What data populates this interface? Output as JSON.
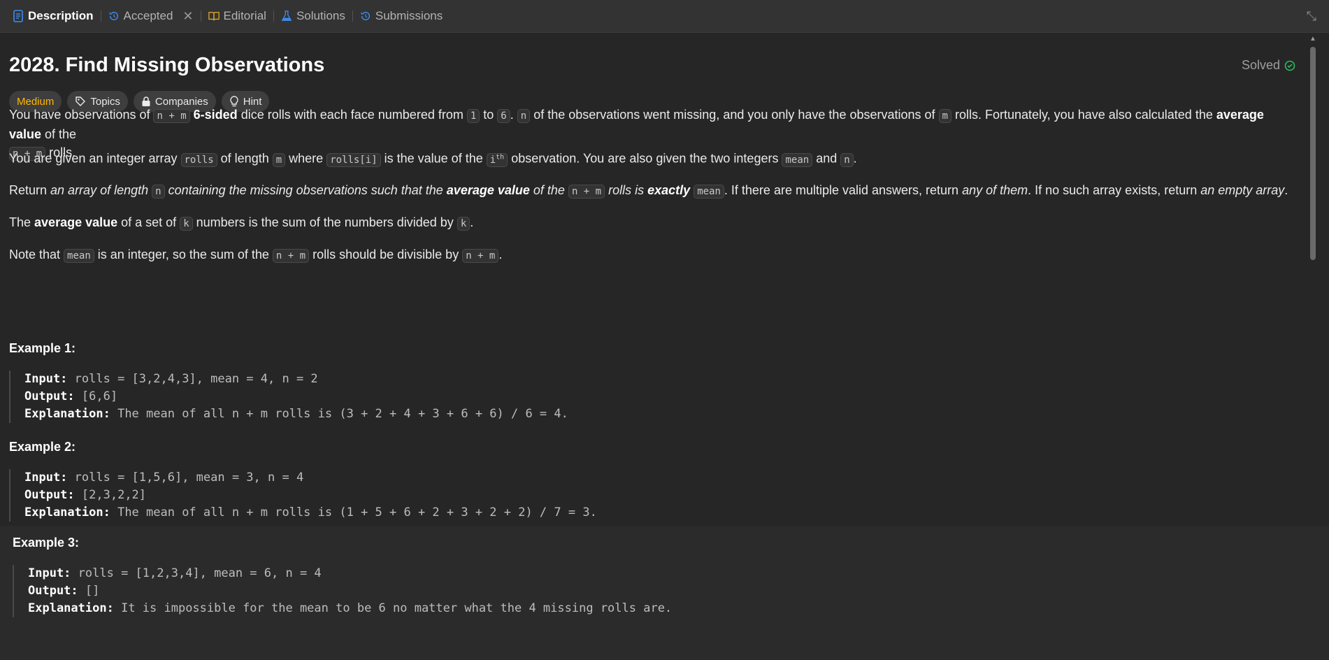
{
  "tabs": [
    {
      "label": "Description",
      "icon": "document-icon",
      "active": true
    },
    {
      "label": "Accepted",
      "icon": "history-icon",
      "closable": true
    },
    {
      "label": "Editorial",
      "icon": "book-icon"
    },
    {
      "label": "Solutions",
      "icon": "flask-icon"
    },
    {
      "label": "Submissions",
      "icon": "history-icon"
    }
  ],
  "problem": {
    "title": "2028. Find Missing Observations",
    "status": "Solved",
    "difficulty": "Medium",
    "tags": [
      "Topics",
      "Companies",
      "Hint"
    ]
  },
  "description": {
    "p1_a": "You have observations of ",
    "p1_code1": "n + m",
    "p1_b": "6-sided",
    "p1_c": " dice rolls with each face numbered from ",
    "p1_code2": "1",
    "p1_d": " to ",
    "p1_code3": "6",
    "p1_e": ". ",
    "p1_code4": "n",
    "p1_f": " of the observations went missing, and you only have the observations of ",
    "p1_code5": "m",
    "p1_g": " rolls. Fortunately, you have also calculated the ",
    "p1_h": "average value",
    "p1_i": " of the",
    "p1_code6": "n + m",
    "p1_j": " rolls.",
    "p2_a": "You are given an integer array ",
    "p2_code1": "rolls",
    "p2_b": " of length ",
    "p2_code2": "m",
    "p2_c": " where ",
    "p2_code3": "rolls[i]",
    "p2_d": " is the value of the ",
    "p2_code4": "i",
    "p2_sup": "th",
    "p2_e": " observation. You are also given the two integers ",
    "p2_code5": "mean",
    "p2_f": " and ",
    "p2_code6": "n",
    "p2_g": ".",
    "p3_a": "Return ",
    "p3_b": "an array of length ",
    "p3_code1": "n",
    "p3_c": " containing the missing observations such that the ",
    "p3_d": "average value",
    "p3_e": " of the ",
    "p3_code2": "n + m",
    "p3_f": " rolls is ",
    "p3_g": "exactly",
    "p3_code3": "mean",
    "p3_h": ". If there are multiple valid answers, return ",
    "p3_i": "any of them",
    "p3_j": ". If no such array exists, return ",
    "p3_k": "an empty array",
    "p3_l": ".",
    "p4_a": "The ",
    "p4_b": "average value",
    "p4_c": " of a set of ",
    "p4_code1": "k",
    "p4_d": " numbers is the sum of the numbers divided by ",
    "p4_code2": "k",
    "p4_e": ".",
    "p5_a": "Note that ",
    "p5_code1": "mean",
    "p5_b": " is an integer, so the sum of the ",
    "p5_code2": "n + m",
    "p5_c": " rolls should be divisible by ",
    "p5_code3": "n + m",
    "p5_d": "."
  },
  "examples": [
    {
      "heading": "Example 1:",
      "input_label": "Input:",
      "input": "rolls = [3,2,4,3], mean = 4, n = 2",
      "output_label": "Output:",
      "output": "[6,6]",
      "explanation_label": "Explanation:",
      "explanation": "The mean of all n + m rolls is (3 + 2 + 4 + 3 + 6 + 6) / 6 = 4."
    },
    {
      "heading": "Example 2:",
      "input_label": "Input:",
      "input": "rolls = [1,5,6], mean = 3, n = 4",
      "output_label": "Output:",
      "output": "[2,3,2,2]",
      "explanation_label": "Explanation:",
      "explanation": "The mean of all n + m rolls is (1 + 5 + 6 + 2 + 3 + 2 + 2) / 7 = 3."
    },
    {
      "heading": "Example 3:",
      "input_label": "Input:",
      "input": "rolls = [1,2,3,4], mean = 6, n = 4",
      "output_label": "Output:",
      "output": "[]",
      "explanation_label": "Explanation:",
      "explanation": "It is impossible for the mean to be 6 no matter what the 4 missing rolls are."
    }
  ],
  "colors": {
    "background": "#262626",
    "tabbar": "#333333",
    "medium": "#ffb800",
    "solved_check": "#2cbb5d",
    "link_icon": "#3c8cf0",
    "editorial_icon": "#d8a22e"
  }
}
